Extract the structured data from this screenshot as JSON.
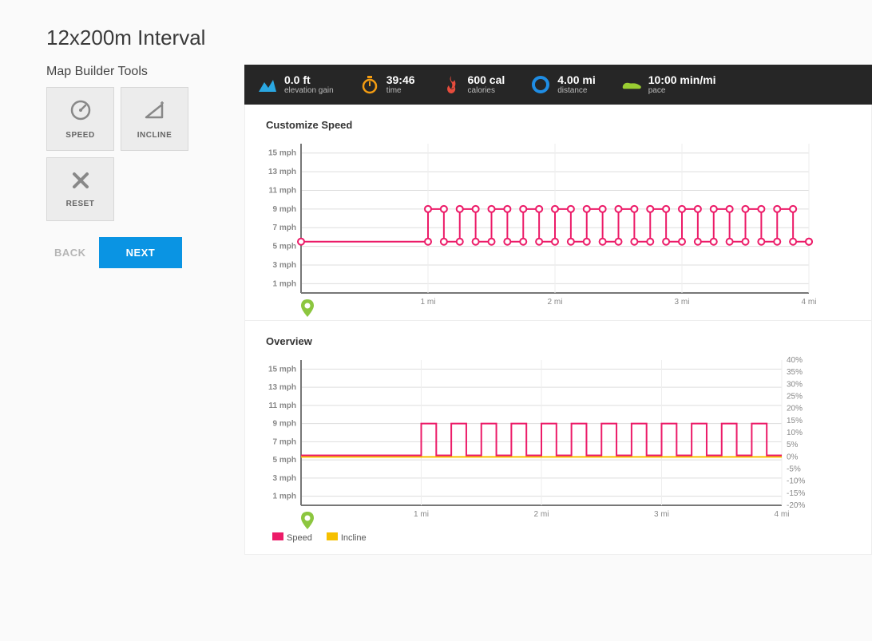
{
  "title": "12x200m Interval",
  "tools": {
    "heading": "Map Builder Tools",
    "speed": "SPEED",
    "incline": "INCLINE",
    "reset": "RESET"
  },
  "nav": {
    "back": "BACK",
    "next": "NEXT"
  },
  "stats": {
    "elevation": {
      "value": "0.0 ft",
      "label": "elevation gain"
    },
    "time": {
      "value": "39:46",
      "label": "time"
    },
    "calories": {
      "value": "600 cal",
      "label": "calories"
    },
    "distance": {
      "value": "4.00 mi",
      "label": "distance"
    },
    "pace": {
      "value": "10:00 min/mi",
      "label": "pace"
    }
  },
  "customize": {
    "title": "Customize Speed",
    "yticks": [
      "15 mph",
      "13 mph",
      "11 mph",
      "9 mph",
      "7 mph",
      "5 mph",
      "3 mph",
      "1 mph"
    ],
    "xticks": [
      "1 mi",
      "2 mi",
      "3 mi",
      "4 mi"
    ]
  },
  "overview": {
    "title": "Overview",
    "yticks_left": [
      "15 mph",
      "13 mph",
      "11 mph",
      "9 mph",
      "7 mph",
      "5 mph",
      "3 mph",
      "1 mph"
    ],
    "yticks_right": [
      "40%",
      "35%",
      "30%",
      "25%",
      "20%",
      "15%",
      "10%",
      "5%",
      "0%",
      "-5%",
      "-10%",
      "-15%",
      "-20%"
    ],
    "xticks": [
      "1 mi",
      "2 mi",
      "3 mi",
      "4 mi"
    ],
    "legend": {
      "speed": "Speed",
      "incline": "Incline"
    }
  },
  "chart_data": [
    {
      "type": "line",
      "name": "customize_speed",
      "title": "Customize Speed",
      "xlabel": "",
      "ylabel": "",
      "ylim": [
        0,
        16
      ],
      "xlim": [
        0,
        4
      ],
      "x_units": "mi",
      "y_units": "mph",
      "segments_description": "speed at 5.5 mph from 0 to 1 mi, then 12 intervals alternating 9 mph (0.125 mi each) and 5.5 mph (0.125 mi recovery), ending 5.5 mph to 4 mi, rendered as stepped line with circle markers at segment boundaries",
      "interval_spec": {
        "warmup_mi": 1.0,
        "intervals": 12,
        "work_speed": 9.0,
        "work_dist_mi": 0.125,
        "rest_speed": 5.5,
        "rest_dist_mi": 0.125,
        "cooldown_to_mi": 4.0,
        "cooldown_speed": 5.5
      }
    },
    {
      "type": "line",
      "name": "overview",
      "title": "Overview",
      "xlim": [
        0,
        4
      ],
      "x_units": "mi",
      "series": [
        {
          "name": "Speed",
          "y_units": "mph",
          "ylim": [
            0,
            16
          ],
          "color": "#ec1b68",
          "interval_spec": {
            "warmup_mi": 1.0,
            "intervals": 12,
            "work_speed": 9.0,
            "work_dist_mi": 0.125,
            "rest_speed": 5.5,
            "rest_dist_mi": 0.125,
            "cooldown_to_mi": 4.0,
            "cooldown_speed": 5.5
          }
        },
        {
          "name": "Incline",
          "y_units": "%",
          "ylim": [
            -20,
            40
          ],
          "color": "#f6c000",
          "constant_value": 0
        }
      ],
      "y_left_ticks": [
        1,
        3,
        5,
        7,
        9,
        11,
        13,
        15
      ],
      "y_right_ticks": [
        -20,
        -15,
        -10,
        -5,
        0,
        5,
        10,
        15,
        20,
        25,
        30,
        35,
        40
      ]
    }
  ]
}
